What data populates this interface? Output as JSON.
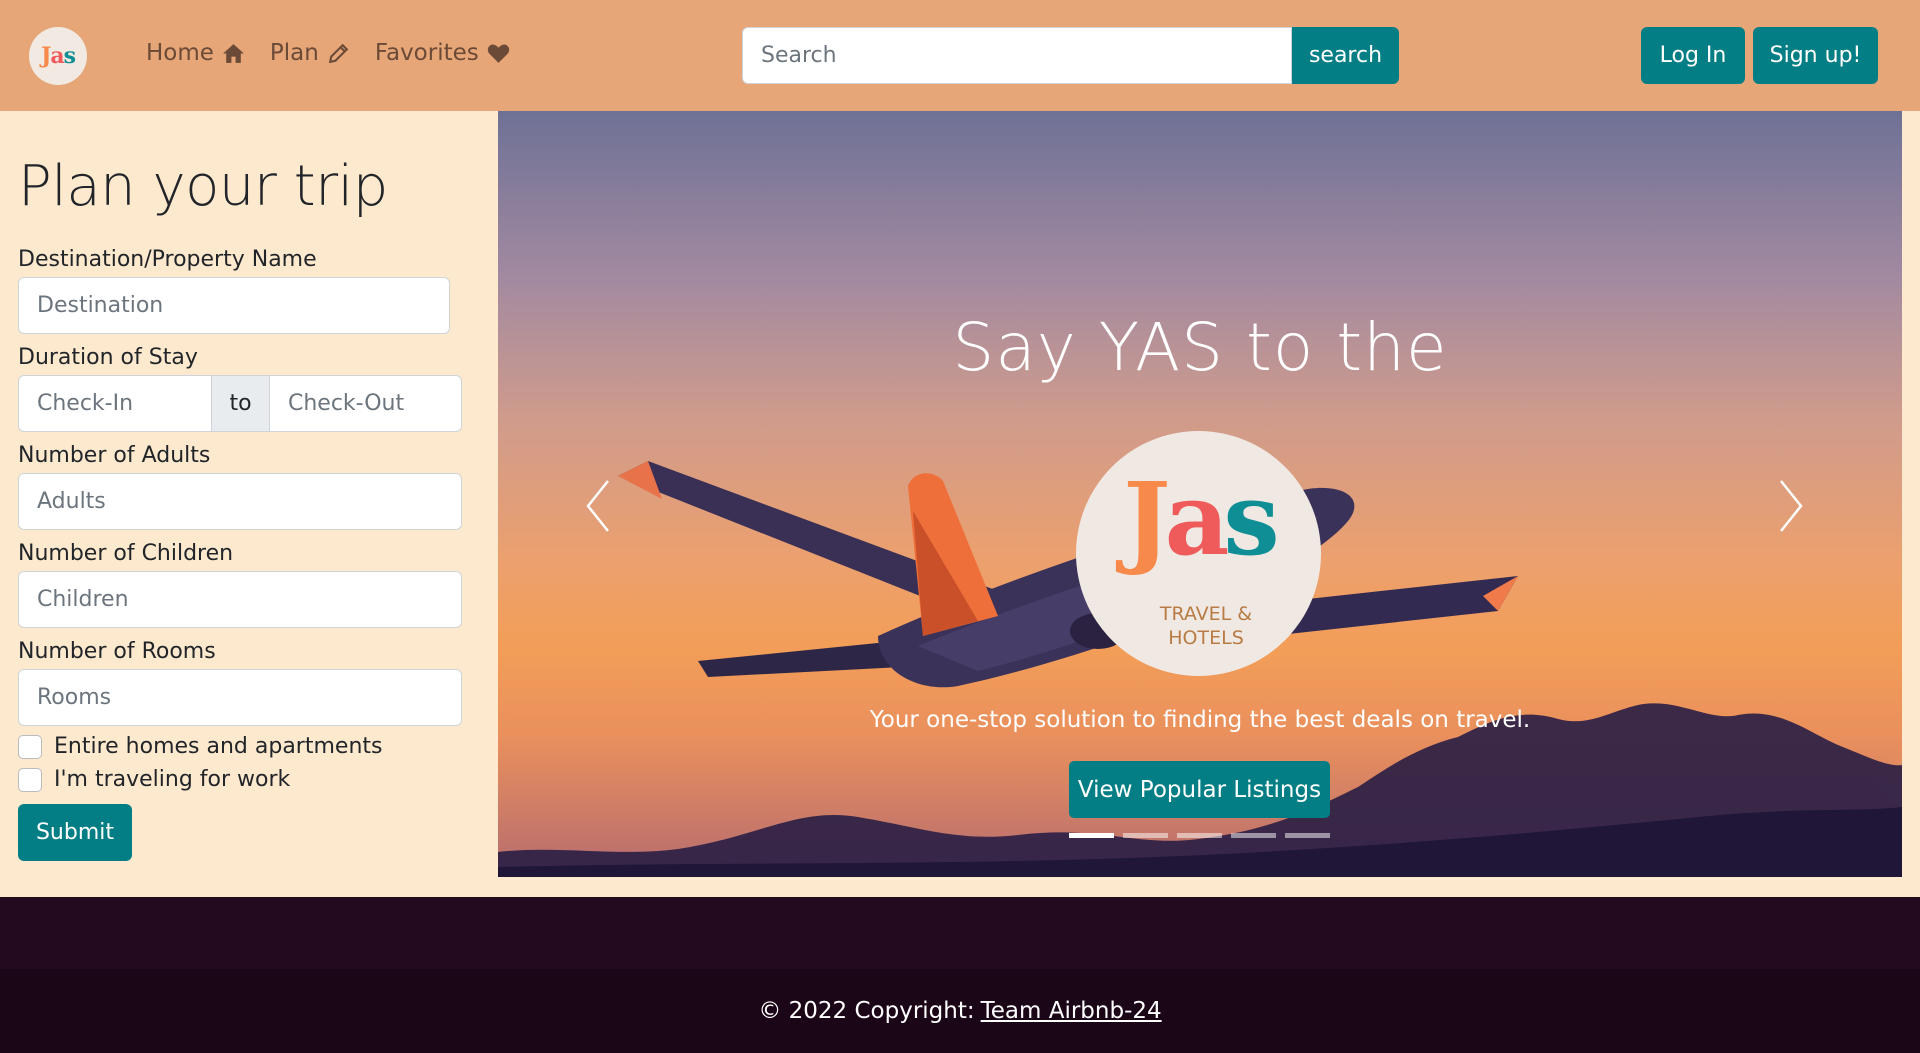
{
  "brand": {
    "logo_letters": [
      "J",
      "a",
      "s"
    ],
    "logo_colors": [
      "#f7894a",
      "#ef5b5b",
      "#0f8e96"
    ],
    "logo_subtitle": "TRAVEL & HOTELS"
  },
  "nav": {
    "links": [
      {
        "label": "Home",
        "icon": "home-icon"
      },
      {
        "label": "Plan",
        "icon": "pencil-icon"
      },
      {
        "label": "Favorites",
        "icon": "heart-icon"
      }
    ],
    "search_placeholder": "Search",
    "search_button": "search",
    "login": "Log In",
    "signup": "Sign up!"
  },
  "form": {
    "title": "Plan your trip",
    "destination_label": "Destination/Property Name",
    "destination_placeholder": "Destination",
    "duration_label": "Duration of Stay",
    "checkin_placeholder": "Check-In",
    "to_text": "to",
    "checkout_placeholder": "Check-Out",
    "adults_label": "Number of Adults",
    "adults_placeholder": "Adults",
    "children_label": "Number of Children",
    "children_placeholder": "Children",
    "rooms_label": "Number of Rooms",
    "rooms_placeholder": "Rooms",
    "checkbox_homes": "Entire homes and apartments",
    "checkbox_work": "I'm traveling for work",
    "submit": "Submit"
  },
  "hero": {
    "heading": "Say YAS to the",
    "logo_subtitle_line1": "TRAVEL &",
    "logo_subtitle_line2": "HOTELS",
    "tagline": "Your one-stop solution to finding the best deals on travel.",
    "button": "View Popular Listings",
    "slide_count": 5,
    "active_slide": 1
  },
  "footer": {
    "copyright": "© 2022 Copyright:",
    "link": "Team Airbnb-24"
  },
  "colors": {
    "navbar": "#e6a677",
    "panel": "#fde9ce",
    "accent": "#047e85",
    "footer_top": "#240a1f",
    "footer_bottom": "#1b0618"
  }
}
